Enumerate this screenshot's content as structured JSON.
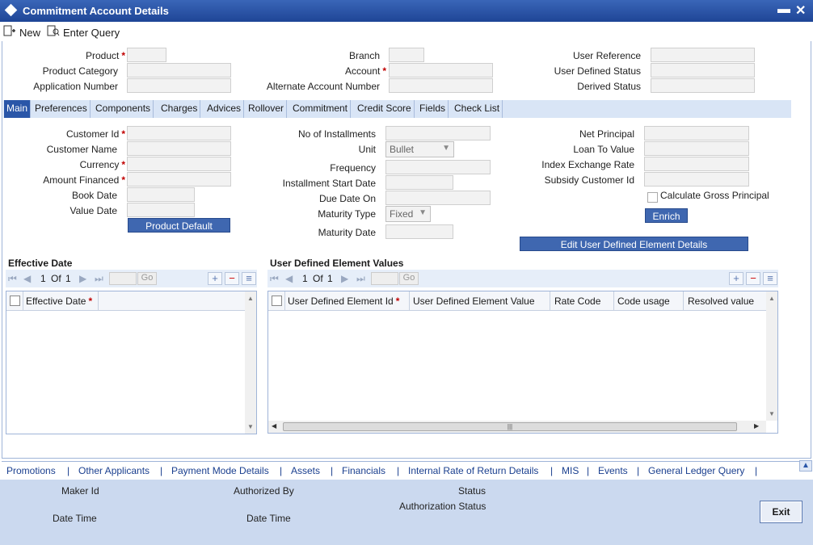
{
  "window": {
    "title": "Commitment Account Details",
    "minimize": "▬",
    "close": "✕"
  },
  "toolbar": {
    "new_label": "New",
    "enter_query_label": "Enter Query"
  },
  "header_fields": {
    "product": "Product",
    "product_category": "Product Category",
    "application_number": "Application Number",
    "branch": "Branch",
    "account": "Account",
    "alternate_account_number": "Alternate Account Number",
    "user_reference": "User Reference",
    "user_defined_status": "User Defined Status",
    "derived_status": "Derived Status"
  },
  "tabs": [
    "Main",
    "Preferences",
    "Components",
    "Charges",
    "Advices",
    "Rollover",
    "Commitment",
    "Credit Score",
    "Fields",
    "Check List"
  ],
  "main": {
    "customer_id": "Customer Id",
    "customer_name": "Customer Name",
    "currency": "Currency",
    "amount_financed": "Amount Financed",
    "book_date": "Book Date",
    "value_date": "Value Date",
    "product_default_button": "Product Default",
    "no_of_installments": "No of Installments",
    "unit": "Unit",
    "unit_value": "Bullet",
    "frequency": "Frequency",
    "installment_start_date": "Installment Start Date",
    "due_date_on": "Due Date On",
    "maturity_type": "Maturity Type",
    "maturity_type_value": "Fixed",
    "maturity_date": "Maturity Date",
    "net_principal": "Net Principal",
    "loan_to_value": "Loan To Value",
    "index_exchange_rate": "Index Exchange Rate",
    "subsidy_customer_id": "Subsidy Customer Id",
    "calculate_gross_principal": "Calculate Gross Principal",
    "enrich_button": "Enrich",
    "edit_ude_button": "Edit User Defined Element Details"
  },
  "effective_date_grid": {
    "title": "Effective Date",
    "page": "1",
    "of_label": "Of",
    "total": "1",
    "go": "Go",
    "columns": [
      "Effective Date"
    ]
  },
  "ude_grid": {
    "title": "User Defined Element Values",
    "page": "1",
    "of_label": "Of",
    "total": "1",
    "go": "Go",
    "columns": [
      "User Defined Element Id",
      "User Defined Element Value",
      "Rate Code",
      "Code usage",
      "Resolved value"
    ]
  },
  "required_marker": "*",
  "bottom_links": [
    "Promotions",
    "Other Applicants",
    "Payment Mode Details",
    "Assets",
    "Financials",
    "Internal Rate of Return Details",
    "MIS",
    "Events",
    "General Ledger Query"
  ],
  "link_separator": "|",
  "footer": {
    "maker_id": "Maker Id",
    "date_time_1": "Date Time",
    "authorized_by": "Authorized By",
    "date_time_2": "Date Time",
    "status": "Status",
    "authorization_status": "Authorization Status",
    "exit_button": "Exit"
  }
}
